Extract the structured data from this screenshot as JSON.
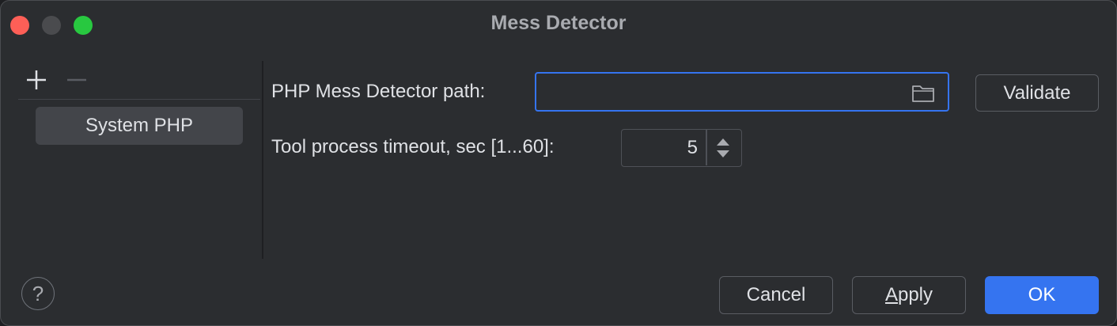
{
  "window": {
    "title": "Mess Detector"
  },
  "sidebar": {
    "add_icon": "plus-icon",
    "remove_icon": "minus-icon",
    "items": [
      {
        "label": "System PHP",
        "selected": true
      }
    ]
  },
  "form": {
    "path_label": "PHP Mess Detector path:",
    "path_value": "",
    "browse_icon": "folder-icon",
    "validate_label": "Validate",
    "timeout_label": "Tool process timeout, sec [1...60]:",
    "timeout_value": "5"
  },
  "footer": {
    "help_label": "?",
    "cancel_label": "Cancel",
    "apply_label_mnemonic": "A",
    "apply_label_rest": "pply",
    "ok_label": "OK"
  },
  "colors": {
    "accent": "#3574f0",
    "background": "#2b2d30",
    "close": "#fe5f57",
    "maximize": "#28c840"
  }
}
